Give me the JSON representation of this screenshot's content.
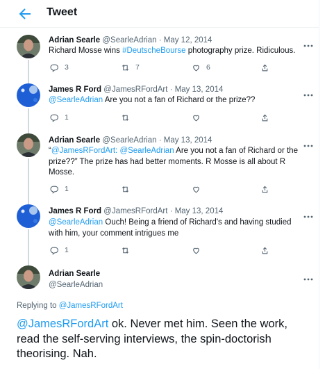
{
  "header": {
    "title": "Tweet"
  },
  "colors": {
    "accent": "#1d9bf0",
    "muted": "#536471",
    "line": "#cfd9de"
  },
  "tweets": [
    {
      "name": "Adrian Searle",
      "handle": "@SearleAdrian",
      "sep": " · ",
      "date": "May 12, 2014",
      "text_before": "Richard Mosse wins ",
      "hashtag": "#DeutscheBourse",
      "text_after": " photography prize. Ridiculous.",
      "replies": "3",
      "retweets": "7",
      "likes": "6"
    },
    {
      "name": "James R Ford",
      "handle": "@JamesRFordArt",
      "sep": " · ",
      "date": "May 13, 2014",
      "mention": "@SearleAdrian",
      "text": " Are you not a fan of Richard or the prize??",
      "replies": "1"
    },
    {
      "name": "Adrian Searle",
      "handle": "@SearleAdrian",
      "sep": " · ",
      "date": "May 13, 2014",
      "quote_open": "“",
      "mention1": "@JamesRFordArt",
      "colon": ": ",
      "mention2": "@SearleAdrian",
      "text": " Are you not a fan of Richard or the prize??” The prize has had better moments. R Mosse is all about R Mosse.",
      "replies": "1"
    },
    {
      "name": "James R Ford",
      "handle": "@JamesRFordArt",
      "sep": " · ",
      "date": "May 13, 2014",
      "mention": "@SearleAdrian",
      "text": " Ouch! Being a friend of Richard's and having studied with him, your comment intrigues me",
      "replies": "1"
    }
  ],
  "main_tweet": {
    "name": "Adrian Searle",
    "handle": "@SearleAdrian",
    "replying_label": "Replying to ",
    "replying_to": "@JamesRFordArt",
    "mention": "@JamesRFordArt",
    "text": " ok. Never met him. Seen the work, read the self-serving interviews, the spin-doctorish theorising. Nah."
  },
  "icons": {
    "back": "arrow-left-icon",
    "more": "more-icon",
    "reply": "reply-icon",
    "retweet": "retweet-icon",
    "like": "heart-icon",
    "share": "share-icon"
  }
}
